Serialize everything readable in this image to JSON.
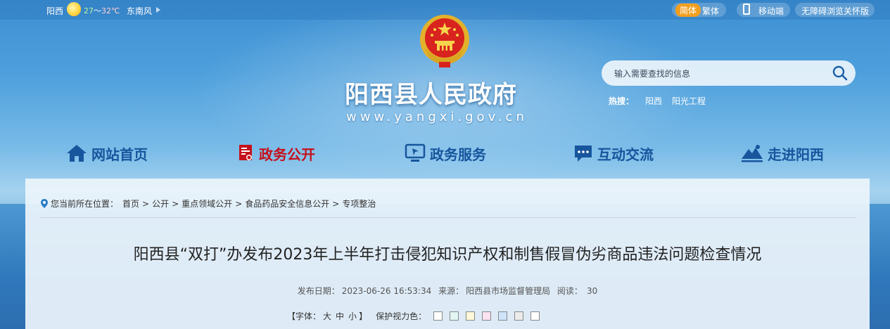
{
  "topbar": {
    "city": "阳西",
    "temp_low": "27",
    "temp_sep": "～",
    "temp_high": "32℃",
    "wind": "东南风",
    "lang_simplified": "简体",
    "lang_traditional": "繁体",
    "mobile": "移动端",
    "accessibility": "无障碍浏览关怀版"
  },
  "header": {
    "site_title": "阳西县人民政府",
    "site_url": "www.yangxi.gov.cn"
  },
  "search": {
    "placeholder": "输入需要查找的信息",
    "hot_label": "热搜：",
    "hot_items": [
      "阳西",
      "阳光工程"
    ]
  },
  "nav": {
    "items": [
      {
        "label": "网站首页",
        "icon": "home-icon"
      },
      {
        "label": "政务公开",
        "icon": "document-icon",
        "active": true
      },
      {
        "label": "政务服务",
        "icon": "monitor-icon"
      },
      {
        "label": "互动交流",
        "icon": "chat-icon"
      },
      {
        "label": "走进阳西",
        "icon": "mountain-icon"
      }
    ]
  },
  "breadcrumb": {
    "prefix": "您当前所在位置：",
    "items": [
      "首页",
      "公开",
      "重点领域公开",
      "食品药品安全信息公开",
      "专项整治"
    ],
    "separator": ">"
  },
  "article": {
    "title": "阳西县“双打”办发布2023年上半年打击侵犯知识产权和制售假冒伪劣商品违法问题检查情况",
    "publish_label": "发布日期：",
    "publish_date": "2023-06-26 16:53:34",
    "source_label": "来源：",
    "source": "阳西县市场监督管理局",
    "views_label": "阅读：",
    "views": "30"
  },
  "tools": {
    "font_label": "【字体：",
    "font_large": "大",
    "font_medium": "中",
    "font_small": "小",
    "font_end": "】",
    "eye_label": "保护视力色：",
    "eye_colors": [
      "#ffffff",
      "#e2f7f4",
      "#fff8d8",
      "#fbe2f2",
      "#cfe4fb",
      "#ececec",
      "#ffffff"
    ]
  },
  "colors": {
    "nav_text": "#17559d",
    "nav_active": "#c5111b",
    "lang_badge": "#f29f1f"
  }
}
